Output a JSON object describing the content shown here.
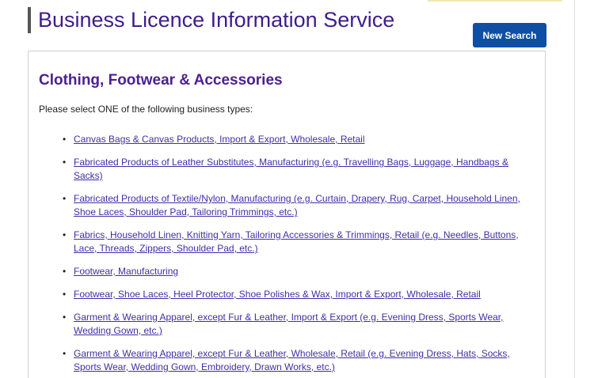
{
  "header": {
    "title": "Business Licence Information Service",
    "new_search_label": "New Search"
  },
  "panel": {
    "heading": "Clothing, Footwear & Accessories",
    "instruction": "Please select ONE of the following business types:",
    "items": [
      {
        "label": "Canvas Bags & Canvas Products, Import & Export, Wholesale, Retail"
      },
      {
        "label": "Fabricated Products of Leather Substitutes, Manufacturing (e.g. Travelling Bags, Luggage, Handbags & Sacks)"
      },
      {
        "label": "Fabricated Products of Textile/Nylon, Manufacturing (e.g. Curtain, Drapery, Rug, Carpet, Household Linen, Shoe Laces, Shoulder Pad, Tailoring Trimmings, etc.)"
      },
      {
        "label": "Fabrics, Household Linen, Knitting Yarn, Tailoring Accessories & Trimmings, Retail (e.g. Needles, Buttons, Lace, Threads, Zippers, Shoulder Pad, etc.)"
      },
      {
        "label": "Footwear, Manufacturing"
      },
      {
        "label": "Footwear, Shoe Laces, Heel Protector, Shoe Polishes & Wax, Import & Export, Wholesale, Retail"
      },
      {
        "label": "Garment & Wearing Apparel, except Fur & Leather, Import & Export (e.g. Evening Dress, Sports Wear, Wedding Gown, etc.)"
      },
      {
        "label": "Garment & Wearing Apparel, except Fur & Leather, Wholesale, Retail (e.g. Evening Dress, Hats, Socks, Sports Wear, Wedding Gown, Embroidery, Drawn Works, etc.)"
      }
    ]
  },
  "colors": {
    "title": "#3f1d8c",
    "heading": "#4b2190",
    "link": "#3f2fa8",
    "button": "#0f4fa3"
  }
}
